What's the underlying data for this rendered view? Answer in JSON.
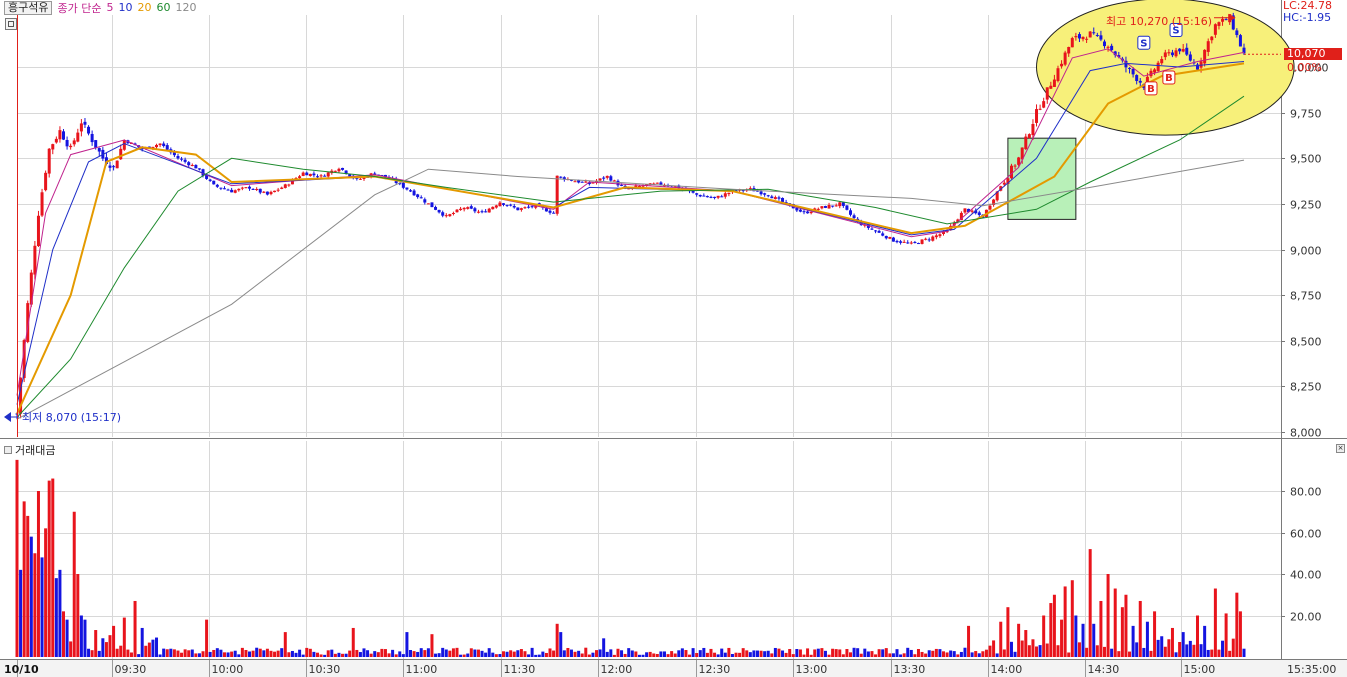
{
  "legend": {
    "stock": "흥구석유",
    "indicator": "종가 단순",
    "ma": [
      {
        "period": "5",
        "color": "#c0248e"
      },
      {
        "period": "10",
        "color": "#1f2fc8"
      },
      {
        "period": "20",
        "color": "#e49a00"
      },
      {
        "period": "60",
        "color": "#1e8a2e"
      },
      {
        "period": "120",
        "color": "#8a8a8a"
      }
    ]
  },
  "volume_title": "거래대금",
  "lc_label": "LC:24.78",
  "hc_label": "HC:-1.95",
  "current_price_label": "10,070",
  "change_label": "0.00%",
  "high_annotation": "최고 10,270 (15:16)",
  "low_annotation": "최저 8,070 (15:17)",
  "date_label": "10/10",
  "end_time_label": "15:35:00",
  "pattern_marks": [
    "S",
    "S",
    "B",
    "B"
  ],
  "colors": {
    "up": "#e8141c",
    "down": "#1414e0",
    "grid": "#d8d8d8",
    "box": "#b8f0b8",
    "ellipse": "#f7f07a"
  },
  "chart_data": [
    {
      "type": "candlestick",
      "title": "",
      "x_ticks": [
        "09:30",
        "10:00",
        "10:30",
        "11:00",
        "11:30",
        "12:00",
        "12:30",
        "13:00",
        "13:30",
        "14:00",
        "14:30",
        "15:00"
      ],
      "y_ticks": [
        "10,000",
        "9,750",
        "9,500",
        "9,250",
        "9,000",
        "8,750",
        "8,500",
        "8,250",
        "8,000"
      ],
      "ylim": [
        8000,
        10270
      ],
      "high": 10270,
      "low": 8070,
      "last": 10070,
      "price_path": [
        [
          0,
          8100
        ],
        [
          3,
          8700
        ],
        [
          6,
          9200
        ],
        [
          9,
          9550
        ],
        [
          12,
          9650
        ],
        [
          15,
          9550
        ],
        [
          18,
          9700
        ],
        [
          21,
          9600
        ],
        [
          24,
          9500
        ],
        [
          27,
          9450
        ],
        [
          30,
          9600
        ],
        [
          35,
          9550
        ],
        [
          40,
          9580
        ],
        [
          45,
          9500
        ],
        [
          50,
          9450
        ],
        [
          55,
          9350
        ],
        [
          60,
          9320
        ],
        [
          65,
          9340
        ],
        [
          70,
          9300
        ],
        [
          75,
          9350
        ],
        [
          80,
          9420
        ],
        [
          85,
          9400
        ],
        [
          90,
          9450
        ],
        [
          95,
          9380
        ],
        [
          100,
          9420
        ],
        [
          105,
          9380
        ],
        [
          110,
          9320
        ],
        [
          115,
          9250
        ],
        [
          120,
          9180
        ],
        [
          125,
          9230
        ],
        [
          130,
          9200
        ],
        [
          135,
          9260
        ],
        [
          140,
          9220
        ],
        [
          145,
          9240
        ],
        [
          150,
          9200
        ],
        [
          151,
          9400
        ],
        [
          155,
          9380
        ],
        [
          160,
          9360
        ],
        [
          165,
          9400
        ],
        [
          170,
          9330
        ],
        [
          175,
          9350
        ],
        [
          180,
          9360
        ],
        [
          185,
          9340
        ],
        [
          190,
          9300
        ],
        [
          195,
          9280
        ],
        [
          200,
          9320
        ],
        [
          205,
          9330
        ],
        [
          210,
          9300
        ],
        [
          215,
          9250
        ],
        [
          220,
          9200
        ],
        [
          225,
          9230
        ],
        [
          230,
          9250
        ],
        [
          235,
          9150
        ],
        [
          240,
          9100
        ],
        [
          245,
          9050
        ],
        [
          250,
          9030
        ],
        [
          255,
          9060
        ],
        [
          260,
          9100
        ],
        [
          265,
          9220
        ],
        [
          270,
          9180
        ],
        [
          275,
          9350
        ],
        [
          280,
          9500
        ],
        [
          285,
          9750
        ],
        [
          290,
          9950
        ],
        [
          295,
          10150
        ],
        [
          300,
          10180
        ],
        [
          305,
          10120
        ],
        [
          310,
          10000
        ],
        [
          315,
          9900
        ],
        [
          320,
          10050
        ],
        [
          325,
          10100
        ],
        [
          330,
          10000
        ],
        [
          335,
          10230
        ],
        [
          339,
          10270
        ],
        [
          343,
          10070
        ]
      ],
      "moving_averages": [
        {
          "name": "5",
          "path": [
            [
              0,
              8200
            ],
            [
              8,
              9200
            ],
            [
              15,
              9520
            ],
            [
              30,
              9600
            ],
            [
              60,
              9350
            ],
            [
              100,
              9410
            ],
            [
              150,
              9220
            ],
            [
              160,
              9370
            ],
            [
              200,
              9320
            ],
            [
              250,
              9070
            ],
            [
              260,
              9100
            ],
            [
              280,
              9450
            ],
            [
              295,
              10050
            ],
            [
              305,
              10100
            ],
            [
              315,
              9950
            ],
            [
              330,
              10030
            ],
            [
              343,
              10080
            ]
          ]
        },
        {
          "name": "10",
          "path": [
            [
              0,
              8150
            ],
            [
              10,
              9000
            ],
            [
              20,
              9480
            ],
            [
              30,
              9580
            ],
            [
              60,
              9360
            ],
            [
              100,
              9400
            ],
            [
              150,
              9230
            ],
            [
              160,
              9340
            ],
            [
              200,
              9320
            ],
            [
              250,
              9080
            ],
            [
              262,
              9110
            ],
            [
              285,
              9500
            ],
            [
              300,
              9980
            ],
            [
              310,
              10020
            ],
            [
              325,
              10000
            ],
            [
              343,
              10030
            ]
          ]
        },
        {
          "name": "20",
          "path": [
            [
              0,
              8100
            ],
            [
              15,
              8750
            ],
            [
              25,
              9480
            ],
            [
              35,
              9560
            ],
            [
              50,
              9520
            ],
            [
              60,
              9370
            ],
            [
              100,
              9400
            ],
            [
              150,
              9230
            ],
            [
              170,
              9340
            ],
            [
              200,
              9320
            ],
            [
              250,
              9090
            ],
            [
              265,
              9130
            ],
            [
              290,
              9400
            ],
            [
              305,
              9800
            ],
            [
              320,
              9950
            ],
            [
              343,
              10020
            ]
          ]
        },
        {
          "name": "60",
          "path": [
            [
              0,
              8080
            ],
            [
              15,
              8400
            ],
            [
              30,
              8900
            ],
            [
              45,
              9320
            ],
            [
              60,
              9500
            ],
            [
              80,
              9440
            ],
            [
              100,
              9400
            ],
            [
              120,
              9340
            ],
            [
              150,
              9260
            ],
            [
              180,
              9320
            ],
            [
              210,
              9330
            ],
            [
              240,
              9230
            ],
            [
              260,
              9140
            ],
            [
              285,
              9220
            ],
            [
              300,
              9370
            ],
            [
              325,
              9600
            ],
            [
              343,
              9840
            ]
          ]
        },
        {
          "name": "120",
          "path": [
            [
              0,
              8070
            ],
            [
              60,
              8700
            ],
            [
              100,
              9300
            ],
            [
              115,
              9440
            ],
            [
              140,
              9400
            ],
            [
              200,
              9330
            ],
            [
              250,
              9280
            ],
            [
              270,
              9240
            ],
            [
              300,
              9340
            ],
            [
              343,
              9490
            ]
          ]
        }
      ]
    },
    {
      "type": "bar",
      "title": "거래대금",
      "y_ticks": [
        "80.00",
        "60.00",
        "40.00",
        "20.00"
      ],
      "ylim": [
        0,
        95
      ],
      "spikes": [
        {
          "x": 0,
          "v": 95,
          "up": true
        },
        {
          "x": 1,
          "v": 42,
          "up": false
        },
        {
          "x": 2,
          "v": 75,
          "up": true
        },
        {
          "x": 3,
          "v": 68,
          "up": true
        },
        {
          "x": 4,
          "v": 58,
          "up": false
        },
        {
          "x": 5,
          "v": 50,
          "up": true
        },
        {
          "x": 6,
          "v": 80,
          "up": true
        },
        {
          "x": 7,
          "v": 48,
          "up": false
        },
        {
          "x": 8,
          "v": 62,
          "up": true
        },
        {
          "x": 9,
          "v": 85,
          "up": true
        },
        {
          "x": 10,
          "v": 86,
          "up": true
        },
        {
          "x": 11,
          "v": 38,
          "up": false
        },
        {
          "x": 12,
          "v": 42,
          "up": false
        },
        {
          "x": 13,
          "v": 22,
          "up": true
        },
        {
          "x": 14,
          "v": 18,
          "up": false
        },
        {
          "x": 16,
          "v": 70,
          "up": true
        },
        {
          "x": 17,
          "v": 40,
          "up": true
        },
        {
          "x": 18,
          "v": 20,
          "up": false
        },
        {
          "x": 19,
          "v": 18,
          "up": false
        },
        {
          "x": 22,
          "v": 13,
          "up": true
        },
        {
          "x": 27,
          "v": 15,
          "up": true
        },
        {
          "x": 30,
          "v": 19,
          "up": true
        },
        {
          "x": 33,
          "v": 27,
          "up": true
        },
        {
          "x": 35,
          "v": 14,
          "up": false
        },
        {
          "x": 53,
          "v": 18,
          "up": true
        },
        {
          "x": 75,
          "v": 12,
          "up": true
        },
        {
          "x": 94,
          "v": 14,
          "up": true
        },
        {
          "x": 109,
          "v": 12,
          "up": false
        },
        {
          "x": 116,
          "v": 11,
          "up": true
        },
        {
          "x": 151,
          "v": 16,
          "up": true
        },
        {
          "x": 152,
          "v": 12,
          "up": false
        },
        {
          "x": 164,
          "v": 9,
          "up": false
        },
        {
          "x": 266,
          "v": 15,
          "up": true
        },
        {
          "x": 275,
          "v": 17,
          "up": true
        },
        {
          "x": 277,
          "v": 24,
          "up": true
        },
        {
          "x": 280,
          "v": 16,
          "up": true
        },
        {
          "x": 282,
          "v": 13,
          "up": true
        },
        {
          "x": 287,
          "v": 20,
          "up": true
        },
        {
          "x": 289,
          "v": 26,
          "up": true
        },
        {
          "x": 290,
          "v": 30,
          "up": true
        },
        {
          "x": 292,
          "v": 18,
          "up": true
        },
        {
          "x": 293,
          "v": 34,
          "up": true
        },
        {
          "x": 295,
          "v": 37,
          "up": true
        },
        {
          "x": 296,
          "v": 20,
          "up": false
        },
        {
          "x": 298,
          "v": 16,
          "up": false
        },
        {
          "x": 300,
          "v": 52,
          "up": true
        },
        {
          "x": 301,
          "v": 16,
          "up": false
        },
        {
          "x": 303,
          "v": 27,
          "up": true
        },
        {
          "x": 305,
          "v": 40,
          "up": true
        },
        {
          "x": 307,
          "v": 33,
          "up": true
        },
        {
          "x": 309,
          "v": 24,
          "up": true
        },
        {
          "x": 310,
          "v": 30,
          "up": true
        },
        {
          "x": 312,
          "v": 15,
          "up": false
        },
        {
          "x": 314,
          "v": 27,
          "up": true
        },
        {
          "x": 316,
          "v": 17,
          "up": false
        },
        {
          "x": 318,
          "v": 22,
          "up": true
        },
        {
          "x": 320,
          "v": 10,
          "up": false
        },
        {
          "x": 323,
          "v": 14,
          "up": true
        },
        {
          "x": 326,
          "v": 12,
          "up": false
        },
        {
          "x": 330,
          "v": 20,
          "up": true
        },
        {
          "x": 332,
          "v": 15,
          "up": false
        },
        {
          "x": 335,
          "v": 33,
          "up": true
        },
        {
          "x": 338,
          "v": 21,
          "up": true
        },
        {
          "x": 341,
          "v": 31,
          "up": true
        },
        {
          "x": 342,
          "v": 22,
          "up": true
        },
        {
          "x": 343,
          "v": 4,
          "up": false
        }
      ]
    }
  ]
}
